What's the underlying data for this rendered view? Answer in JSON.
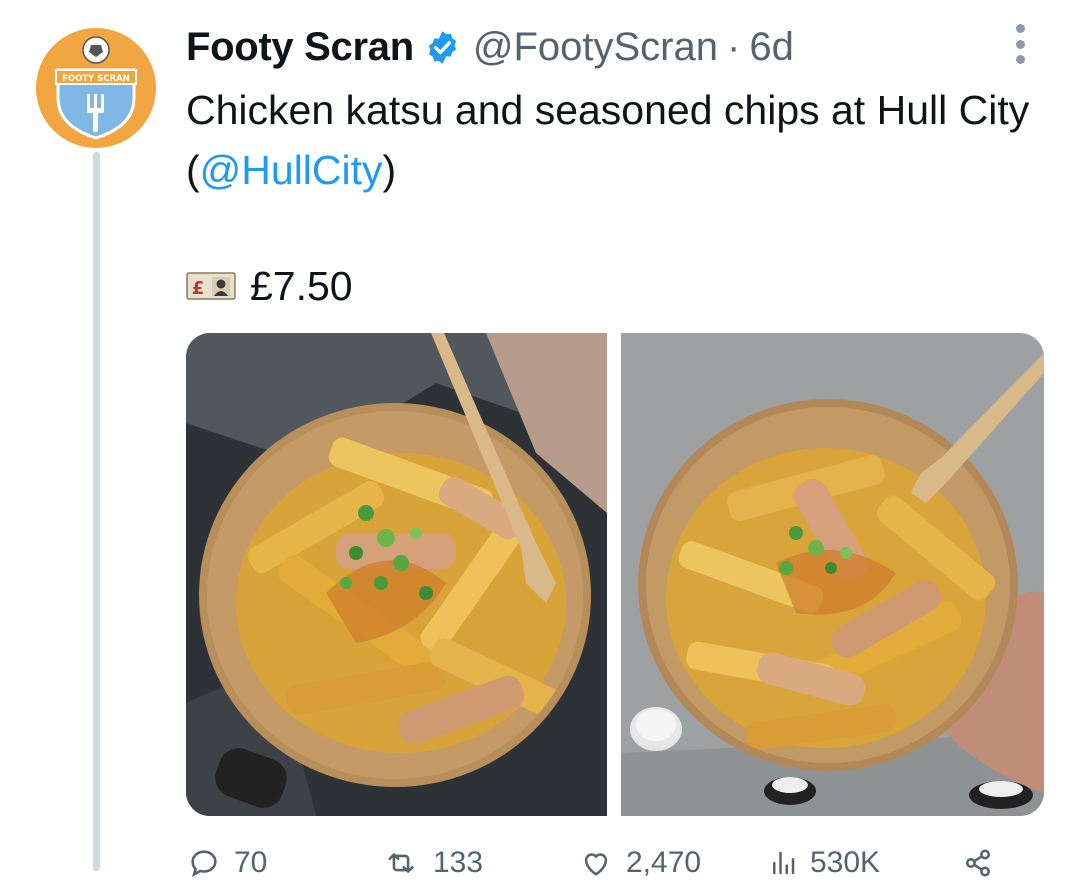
{
  "author": {
    "name": "Footy Scran",
    "handle": "@FootyScran",
    "separator": "·",
    "age": "6d",
    "verified": true,
    "avatar_text": "FOOTY SCRAN"
  },
  "tweet": {
    "text_before": "Chicken katsu and seasoned chips at Hull City (",
    "mention": "@HullCity",
    "text_after": ")",
    "price_emoji": "banknote-pound-emoji",
    "price": "£7.50"
  },
  "media": {
    "images": [
      "katsu-chips-bowl-photo-1",
      "katsu-chips-bowl-photo-2"
    ]
  },
  "actions": {
    "replies": "70",
    "reposts": "133",
    "likes": "2,470",
    "views": "530K"
  },
  "colors": {
    "accent": "#1d9bf0",
    "secondary_text": "#536471",
    "thread_line": "#cfd9de",
    "avatar_bg": "#f2a641"
  },
  "icons": [
    "verified-badge-icon",
    "more-options-icon",
    "reply-icon",
    "repost-icon",
    "like-icon",
    "views-icon",
    "share-icon"
  ]
}
